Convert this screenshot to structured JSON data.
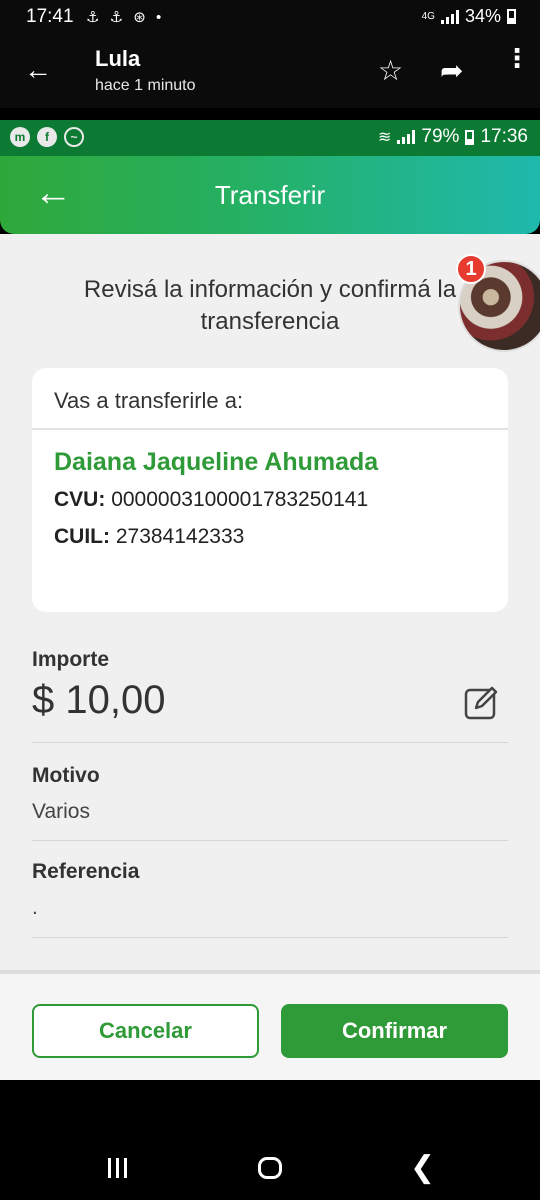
{
  "outer_status": {
    "time": "17:41",
    "icons": "⚓ ⚓ ⊛ •",
    "network": "4G",
    "battery": "34%"
  },
  "chat_header": {
    "contact_name": "Lula",
    "subtitle": "hace 1 minuto"
  },
  "inner_status": {
    "battery": "79%",
    "time": "17:36"
  },
  "app": {
    "title": "Transferir",
    "instruction": "Revisá la información y confirmá la transferencia",
    "notification_count": "1"
  },
  "recipient_card": {
    "header": "Vas a transferirle a:",
    "name": "Daiana Jaqueline Ahumada",
    "cvu_label": "CVU:",
    "cvu_value": "0000003100001783250141",
    "cuil_label": "CUIL:",
    "cuil_value": "27384142333"
  },
  "fields": {
    "importe_label": "Importe",
    "importe_value": "$ 10,00",
    "motivo_label": "Motivo",
    "motivo_value": "Varios",
    "referencia_label": "Referencia",
    "referencia_value": "."
  },
  "buttons": {
    "cancel": "Cancelar",
    "confirm": "Confirmar"
  },
  "colors": {
    "brand_green": "#2f9a38",
    "header_gradient_start": "#2fa83a",
    "header_gradient_end": "#1fb9ad",
    "badge_red": "#e63b2e"
  }
}
